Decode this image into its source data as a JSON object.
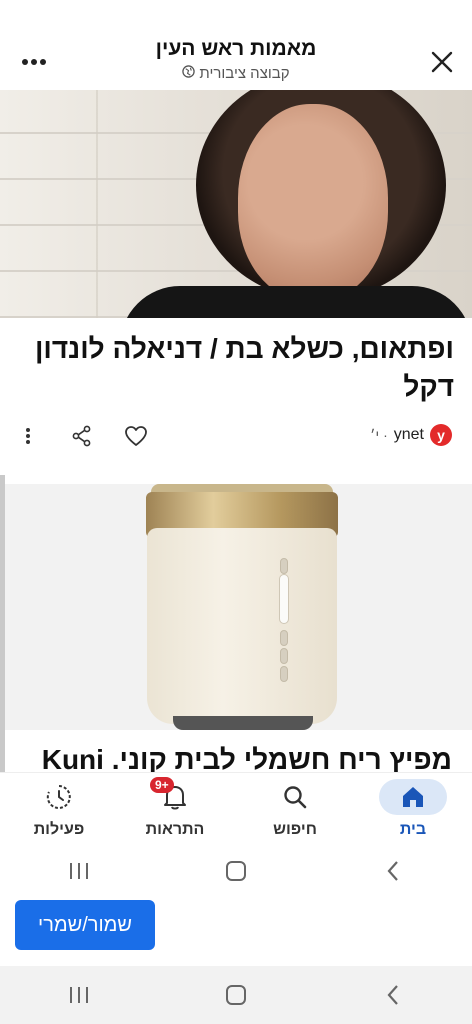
{
  "header": {
    "title": "מאמות ראש העין",
    "subtitle": "קבוצה ציבורית",
    "globe_icon": "globe-icon",
    "more_icon": "more-horizontal-icon",
    "close_icon": "close-icon"
  },
  "article1": {
    "title": "ופתאום, כשלא בת / דניאלה לונדון דקל",
    "source_logo": "y",
    "source_name": "ynet",
    "source_time": "· י׳",
    "actions": [
      "like-icon",
      "share-icon",
      "more-vertical-icon"
    ]
  },
  "article2": {
    "title": "מפיץ ריח חשמלי לבית קוני. Kuni"
  },
  "bottom_nav": {
    "items": [
      {
        "label": "בית",
        "icon": "home-icon",
        "active": true
      },
      {
        "label": "חיפוש",
        "icon": "search-icon",
        "active": false
      },
      {
        "label": "התראות",
        "icon": "bell-icon",
        "badge": "9+",
        "active": false
      },
      {
        "label": "פעילות",
        "icon": "activity-icon",
        "active": false
      }
    ]
  },
  "save_button": {
    "label": "שמור/שמרי"
  },
  "colors": {
    "accent": "#1a6ee8",
    "active_nav": "#1a56b8",
    "badge": "#d8262f",
    "ynet_red": "#e32a2a"
  }
}
